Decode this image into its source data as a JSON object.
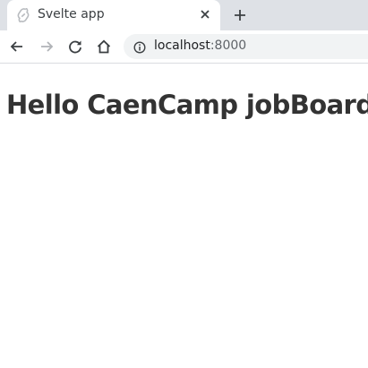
{
  "browser": {
    "tab": {
      "title": "Svelte app",
      "favicon": "svelte-logo-icon",
      "close_icon": "close-icon"
    },
    "new_tab_icon": "plus-icon",
    "nav": {
      "back_icon": "arrow-left-icon",
      "forward_icon": "arrow-right-icon",
      "reload_icon": "reload-icon",
      "home_icon": "home-icon"
    },
    "address": {
      "info_icon": "info-icon",
      "host": "localhost",
      "port": ":8000"
    }
  },
  "page": {
    "heading": "Hello CaenCamp jobBoard!"
  },
  "colors": {
    "tabbar_bg": "#dee1e6",
    "omnibox_bg": "#f1f3f4",
    "heading": "#333333"
  }
}
